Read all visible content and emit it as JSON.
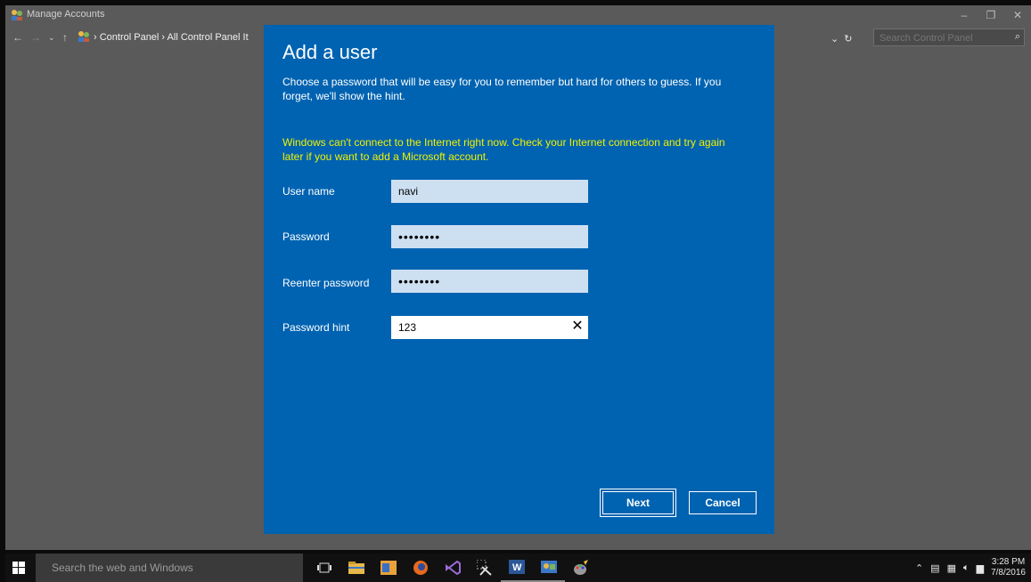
{
  "window": {
    "title": "Manage Accounts",
    "controls": [
      "–",
      "❐",
      "✕"
    ]
  },
  "addressbar": {
    "breadcrumb": "› Control Panel › All Control Panel It",
    "search_placeholder": "Search Control Panel"
  },
  "dialog": {
    "title": "Add a user",
    "description": "Choose a password that will be easy for you to remember but hard for others to guess. If you forget, we'll show the hint.",
    "warning": "Windows can't connect to the Internet right now. Check your Internet connection and try again later if you want to add a Microsoft account.",
    "fields": {
      "username": {
        "label": "User name",
        "value": "navi"
      },
      "password": {
        "label": "Password",
        "value": "••••••••"
      },
      "reenter": {
        "label": "Reenter password",
        "value": "••••••••"
      },
      "hint": {
        "label": "Password hint",
        "value": "123"
      }
    },
    "buttons": {
      "next": "Next",
      "cancel": "Cancel"
    },
    "colors": {
      "background": "#0063b1",
      "warning": "#f2f200"
    }
  },
  "taskbar": {
    "search_placeholder": "Search the web and Windows",
    "clock_time": "3:28 PM",
    "clock_date": "7/8/2016"
  }
}
